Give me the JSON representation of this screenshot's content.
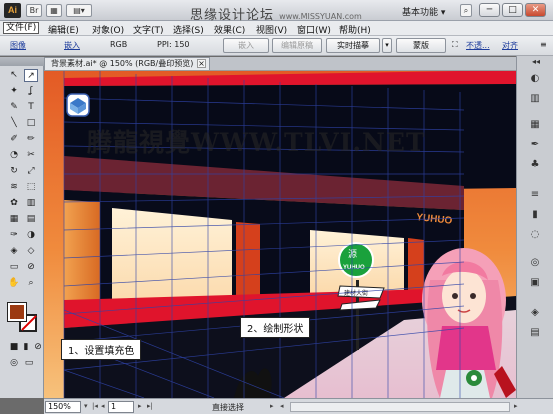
{
  "titlebar": {
    "app_logo": "Ai",
    "title_main": "思缘设计论坛",
    "title_sub": "www.MISSYUAN.com",
    "workspace": "基本功能",
    "buttons": [
      "─",
      "□",
      "✕"
    ]
  },
  "menus": [
    "文件(F)",
    "编辑(E)",
    "对象(O)",
    "文字(T)",
    "选择(S)",
    "效果(C)",
    "视图(V)",
    "窗口(W)",
    "帮助(H)"
  ],
  "control_bar": {
    "link_image": "图像",
    "embed": "嵌入",
    "color_mode": "RGB",
    "ppi": "PPI: 150",
    "btn_embed": "嵌入",
    "btn_edit_original": "编辑原稿",
    "btn_live_trace": "实时描摹",
    "btn_mask": "蒙版",
    "opacity_link": "不透...",
    "align_link": "对齐"
  },
  "document_tab": {
    "label": "背景素材.ai* @ 150% (RGB/叠印预览)",
    "close": "×"
  },
  "watermark": "腾龍視覺WWW.TLVI.NET",
  "storefront": {
    "sign_text": "YUHUO",
    "badge_top": "源",
    "badge_bottom": "YUHUO",
    "street_sign": "建材大街",
    "colors": {
      "sky_top": "#e7612a",
      "sky_bottom": "#f6c27a",
      "building": "#050814",
      "red_band": "#e0142c",
      "guide_blue": "#2f43a8"
    }
  },
  "callouts": {
    "step1": "1、设置填充色",
    "step2": "2、绘制形状"
  },
  "status_bar": {
    "zoom": "150%",
    "page": "1",
    "status_text": "直接选择"
  },
  "tool_icons": [
    "selection-tool",
    "direct-selection-tool",
    "magic-wand-tool",
    "lasso-tool",
    "pen-tool",
    "type-tool",
    "line-tool",
    "rectangle-tool",
    "paintbrush-tool",
    "pencil-tool",
    "blob-brush-tool",
    "eraser-tool",
    "rotate-tool",
    "scale-tool",
    "warp-tool",
    "free-transform-tool",
    "symbol-sprayer-tool",
    "column-graph-tool",
    "mesh-tool",
    "gradient-tool",
    "eyedropper-tool",
    "blend-tool",
    "live-paint-tool",
    "live-paint-selection-tool",
    "artboard-tool",
    "slice-tool",
    "hand-tool",
    "zoom-tool"
  ]
}
